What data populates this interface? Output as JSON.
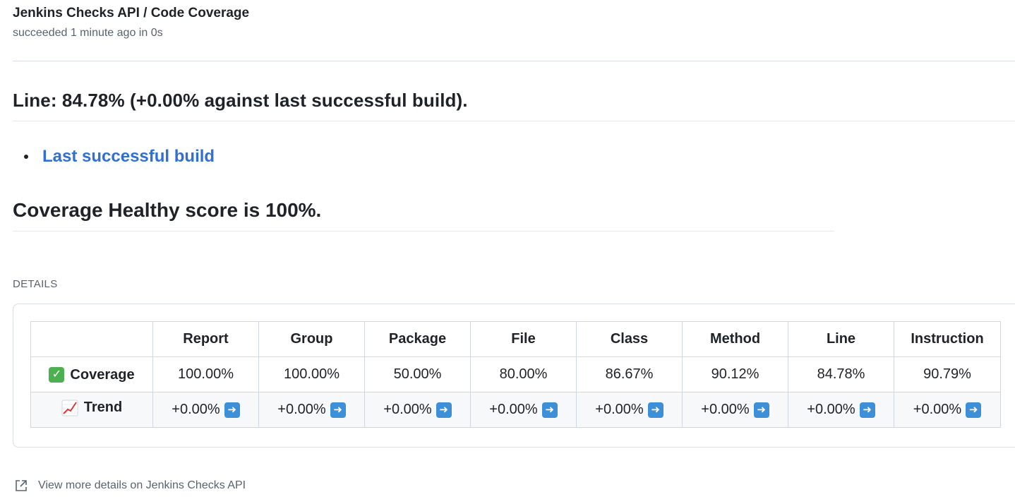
{
  "check": {
    "title": "Jenkins Checks API / Code Coverage",
    "status": "succeeded 1 minute ago in 0s"
  },
  "summary": {
    "line_heading": "Line: 84.78% (+0.00% against last successful build).",
    "links": [
      {
        "label": "Last successful build"
      }
    ],
    "health_heading": "Coverage Healthy score is 100%."
  },
  "details": {
    "label": "DETAILS",
    "table": {
      "columns": [
        "",
        "Report",
        "Group",
        "Package",
        "File",
        "Class",
        "Method",
        "Line",
        "Instruction"
      ],
      "coverage_row": {
        "label": "Coverage",
        "icon": "check-mark-icon",
        "values": [
          "100.00%",
          "100.00%",
          "50.00%",
          "80.00%",
          "86.67%",
          "90.12%",
          "84.78%",
          "90.79%"
        ]
      },
      "trend_row": {
        "label": "Trend",
        "icon": "chart-increasing-icon",
        "values": [
          "+0.00%",
          "+0.00%",
          "+0.00%",
          "+0.00%",
          "+0.00%",
          "+0.00%",
          "+0.00%",
          "+0.00%"
        ],
        "trend_icon": "right-arrow-icon"
      }
    }
  },
  "footer": {
    "link_label": "View more details on Jenkins Checks API",
    "icon": "external-link-icon"
  },
  "colors": {
    "link": "#2f6fd6",
    "check_green": "#4caf50",
    "arrow_blue": "#3d8fd8",
    "muted_text": "#59636e",
    "border": "#d0d7de"
  }
}
